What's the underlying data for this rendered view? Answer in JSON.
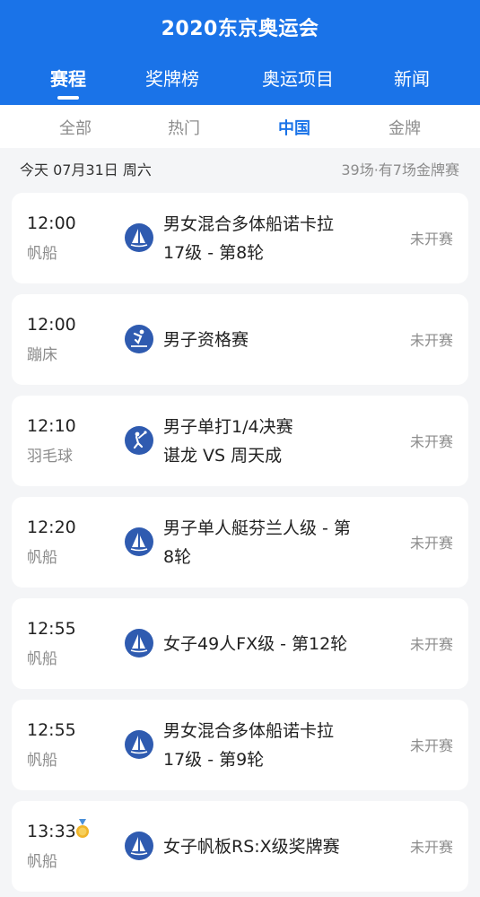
{
  "header": {
    "title": "2020东京奥运会",
    "tabs": [
      {
        "label": "赛程"
      },
      {
        "label": "奖牌榜"
      },
      {
        "label": "奥运项目"
      },
      {
        "label": "新闻"
      }
    ]
  },
  "subtabs": [
    {
      "label": "全部"
    },
    {
      "label": "热门"
    },
    {
      "label": "中国"
    },
    {
      "label": "金牌"
    }
  ],
  "date_row": {
    "date": "今天 07月31日 周六",
    "summary": "39场·有7场金牌赛"
  },
  "events": [
    {
      "time": "12:00",
      "sport": "帆船",
      "line1": "男女混合多体船诺卡拉",
      "line2": "17级 - 第8轮",
      "status": "未开赛",
      "icon": "sailing-icon"
    },
    {
      "time": "12:00",
      "sport": "蹦床",
      "line1": "男子资格赛",
      "line2": "",
      "status": "未开赛",
      "icon": "trampoline-icon"
    },
    {
      "time": "12:10",
      "sport": "羽毛球",
      "line1": "男子单打1/4决赛",
      "line2": "谌龙 VS 周天成",
      "status": "未开赛",
      "icon": "badminton-icon"
    },
    {
      "time": "12:20",
      "sport": "帆船",
      "line1": "男子单人艇芬兰人级 - 第",
      "line2": "8轮",
      "status": "未开赛",
      "icon": "sailing-icon"
    },
    {
      "time": "12:55",
      "sport": "帆船",
      "line1": "女子49人FX级 - 第12轮",
      "line2": "",
      "status": "未开赛",
      "icon": "sailing-icon"
    },
    {
      "time": "12:55",
      "sport": "帆船",
      "line1": "男女混合多体船诺卡拉",
      "line2": "17级 - 第9轮",
      "status": "未开赛",
      "icon": "sailing-icon"
    },
    {
      "time": "13:33",
      "sport": "帆船",
      "line1": "女子帆板RS:X级奖牌赛",
      "line2": "",
      "status": "未开赛",
      "icon": "sailing-icon",
      "medal_icon": "gold-medal-icon"
    }
  ],
  "colors": {
    "brand": "#1a73e8",
    "icon_bg": "#2f5bb0",
    "medal": "#f0b429"
  }
}
